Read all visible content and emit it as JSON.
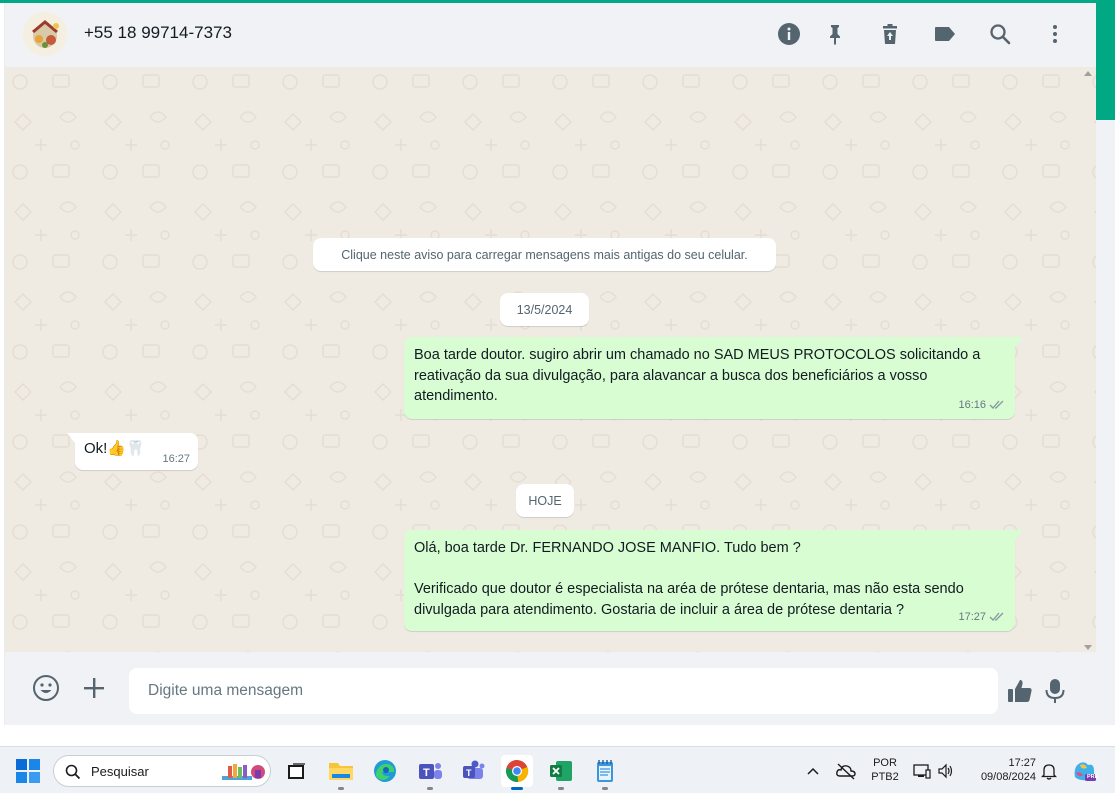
{
  "header": {
    "contact_name": "+55 18 99714-7373",
    "icons": [
      "info-icon",
      "pin-icon",
      "delete-icon",
      "label-icon",
      "search-icon",
      "menu-icon"
    ]
  },
  "chat": {
    "notice": "Clique neste aviso para carregar mensagens mais antigas do seu celular.",
    "date_1": "13/5/2024",
    "date_2": "HOJE",
    "messages": [
      {
        "direction": "out",
        "lines": [
          "Boa tarde doutor. sugiro abrir um chamado no SAD MEUS PROTOCOLOS solicitando a",
          "reativação da sua divulgação, para alavancar a busca dos beneficiários a vosso",
          "atendimento."
        ],
        "time": "16:16",
        "status": "read"
      },
      {
        "direction": "in",
        "text": "Ok!👍🦷",
        "time": "16:27"
      },
      {
        "direction": "out",
        "lines": [
          "Olá, boa tarde Dr. FERNANDO JOSE MANFIO. Tudo bem ?",
          "",
          "Verificado que doutor é especialista na aréa de prótese dentaria, mas não esta sendo",
          "divulgada para atendimento. Gostaria de incluir a área de prótese dentaria ?"
        ],
        "time": "17:27",
        "status": "read"
      }
    ]
  },
  "composer": {
    "placeholder": "Digite uma mensagem"
  },
  "taskbar": {
    "search_placeholder": "Pesquisar",
    "language_top": "POR",
    "language_bottom": "PTB2",
    "time": "17:27",
    "date": "09/08/2024",
    "copilot_badge": "PRE"
  },
  "colors": {
    "accent": "#00a884",
    "outgoing_bubble": "#d9fdd3",
    "chat_bg": "#efeae2",
    "read_ticks": "#8696a0"
  }
}
